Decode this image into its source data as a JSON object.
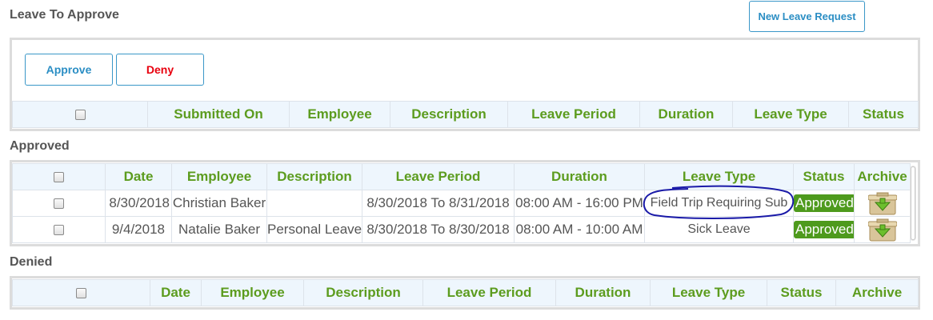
{
  "headings": {
    "leave_to_approve": "Leave To Approve",
    "approved": "Approved",
    "denied": "Denied"
  },
  "toolbar": {
    "new_leave_request": "New Leave Request",
    "approve": "Approve",
    "deny": "Deny"
  },
  "pending_table": {
    "columns": [
      "Submitted On",
      "Employee",
      "Description",
      "Leave Period",
      "Duration",
      "Leave Type",
      "Status"
    ]
  },
  "approved_table": {
    "columns": [
      "Date",
      "Employee",
      "Description",
      "Leave Period",
      "Duration",
      "Leave Type",
      "Status",
      "Archive"
    ],
    "rows": [
      {
        "date": "8/30/2018",
        "employee": "Christian Baker",
        "description": "",
        "leave_period": "8/30/2018 To 8/31/2018",
        "duration": "08:00 AM - 16:00 PM",
        "leave_type": "Field Trip Requiring Sub",
        "status": "Approved"
      },
      {
        "date": "9/4/2018",
        "employee": "Natalie Baker",
        "description": "Personal Leave",
        "leave_period": "8/30/2018 To 8/30/2018",
        "duration": "08:00 AM - 10:00 AM",
        "leave_type": "Sick Leave",
        "status": "Approved"
      }
    ]
  },
  "denied_table": {
    "columns": [
      "Date",
      "Employee",
      "Description",
      "Leave Period",
      "Duration",
      "Leave Type",
      "Status",
      "Archive"
    ]
  },
  "colors": {
    "header_text": "#5c9c1e",
    "header_bg": "#eef6fd",
    "approved_badge": "#4e9a1d",
    "button_border": "#3a97c8",
    "deny_text": "#e8000e",
    "annotation_circle": "#1a1aa8"
  }
}
